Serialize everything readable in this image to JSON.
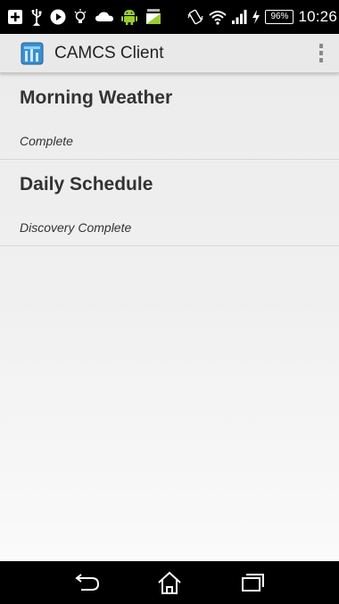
{
  "status_bar": {
    "icons_left": [
      "add-icon",
      "usb-icon",
      "play-icon",
      "lightbulb-icon",
      "cloud-icon",
      "android-icon",
      "data-icon"
    ],
    "icons_right": [
      "vibrate-icon",
      "wifi-icon",
      "signal-icon",
      "charging-icon"
    ],
    "battery": "96%",
    "time": "10:26"
  },
  "action_bar": {
    "title": "CAMCS Client",
    "accent_color": "#3b8fd0"
  },
  "items": [
    {
      "title": "Morning Weather",
      "status": "Complete"
    },
    {
      "title": "Daily Schedule",
      "status": "Discovery Complete"
    }
  ],
  "nav_bar": {
    "buttons": [
      "back-icon",
      "home-icon",
      "recents-icon"
    ]
  }
}
